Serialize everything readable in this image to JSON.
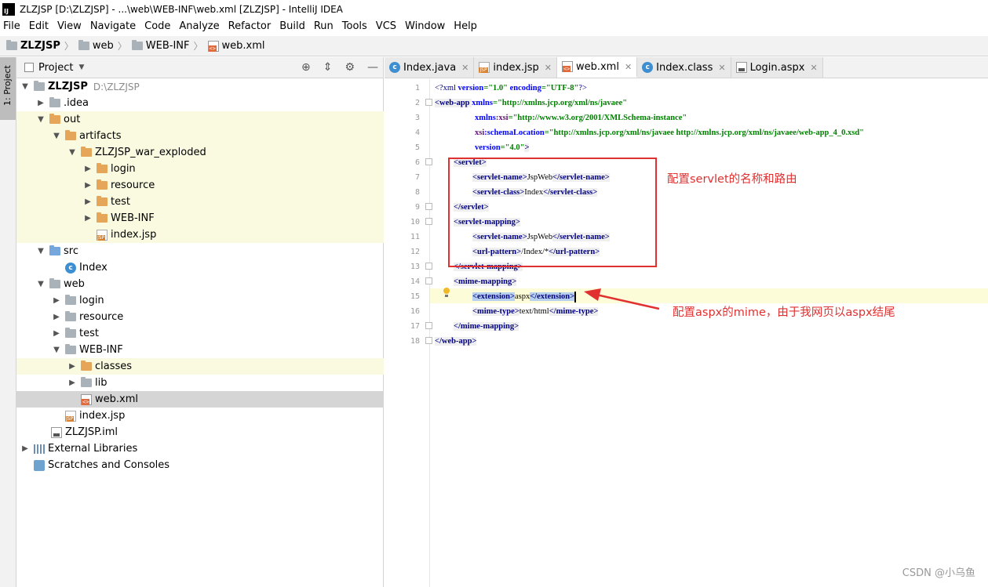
{
  "window": {
    "title": "ZLZJSP [D:\\ZLZJSP] - ...\\web\\WEB-INF\\web.xml [ZLZJSP] - IntelliJ IDEA",
    "app_icon": "IJ"
  },
  "menu": [
    "File",
    "Edit",
    "View",
    "Navigate",
    "Code",
    "Analyze",
    "Refactor",
    "Build",
    "Run",
    "Tools",
    "VCS",
    "Window",
    "Help"
  ],
  "breadcrumb": [
    "ZLZJSP",
    "web",
    "WEB-INF",
    "web.xml"
  ],
  "toolstrip": {
    "project_tab": "1: Project"
  },
  "project": {
    "header": "Project",
    "tree": [
      {
        "label": "ZLZJSP",
        "path": "D:\\ZLZJSP"
      },
      {
        "label": ".idea"
      },
      {
        "label": "out"
      },
      {
        "label": "artifacts"
      },
      {
        "label": "ZLZJSP_war_exploded"
      },
      {
        "label": "login"
      },
      {
        "label": "resource"
      },
      {
        "label": "test"
      },
      {
        "label": "WEB-INF"
      },
      {
        "label": "index.jsp"
      },
      {
        "label": "src"
      },
      {
        "label": "Index"
      },
      {
        "label": "web"
      },
      {
        "label": "login"
      },
      {
        "label": "resource"
      },
      {
        "label": "test"
      },
      {
        "label": "WEB-INF"
      },
      {
        "label": "classes"
      },
      {
        "label": "lib"
      },
      {
        "label": "web.xml"
      },
      {
        "label": "index.jsp"
      },
      {
        "label": "ZLZJSP.iml"
      },
      {
        "label": "External Libraries"
      },
      {
        "label": "Scratches and Consoles"
      }
    ]
  },
  "tabs": [
    "Index.java",
    "index.jsp",
    "web.xml",
    "Index.class",
    "Login.aspx"
  ],
  "editor": {
    "line_numbers": [
      "1",
      "2",
      "3",
      "4",
      "5",
      "6",
      "7",
      "8",
      "9",
      "10",
      "11",
      "12",
      "13",
      "14",
      "15",
      "16",
      "17",
      "18"
    ],
    "code": {
      "l1_pi_open": "<?xml ",
      "l1_a1": "version",
      "l1_v1": "=\"1.0\"",
      "l1_a2": " encoding",
      "l1_v2": "=\"UTF-8\"",
      "l1_pi_close": "?>",
      "l2_tag": "<web-app ",
      "l2_attr": "xmlns",
      "l2_val": "=\"http://xmlns.jcp.org/xml/ns/javaee\"",
      "l3_ns": "xmlns",
      "l3_attr": ":xsi",
      "l3_val": "=\"http://www.w3.org/2001/XMLSchema-instance\"",
      "l4_ns": "xsi",
      "l4_attr": ":schemaLocation",
      "l4_val": "=\"http://xmlns.jcp.org/xml/ns/javaee http://xmlns.jcp.org/xml/ns/javaee/web-app_4_0.xsd\"",
      "l5_attr": "version",
      "l5_val": "=\"4.0\"",
      "l5_close": ">",
      "l6": "<servlet>",
      "l7_open": "<servlet-name>",
      "l7_text": "JspWeb",
      "l7_close": "</servlet-name>",
      "l8_open": "<servlet-class>",
      "l8_text": "Index",
      "l8_close": "</servlet-class>",
      "l9": "</servlet>",
      "l10": "<servlet-mapping>",
      "l11_open": "<servlet-name>",
      "l11_text": "JspWeb",
      "l11_close": "</servlet-name>",
      "l12_open": "<url-pattern>",
      "l12_text": "/Index/*",
      "l12_close": "</url-pattern>",
      "l13": "</servlet-mapping>",
      "l14": "<mime-mapping>",
      "l15_open": "<extension>",
      "l15_text": "aspx",
      "l15_close": "</extension>",
      "l16_open": "<mime-type>",
      "l16_text": "text/html",
      "l16_close": "</mime-type>",
      "l17": "</mime-mapping>",
      "l18": "</web-app>"
    }
  },
  "annotations": {
    "servlet_note": "配置servlet的名称和路由",
    "mime_note": "配置aspx的mime，由于我网页以aspx结尾",
    "color": "#e03030"
  },
  "watermark": "CSDN @小乌鱼"
}
